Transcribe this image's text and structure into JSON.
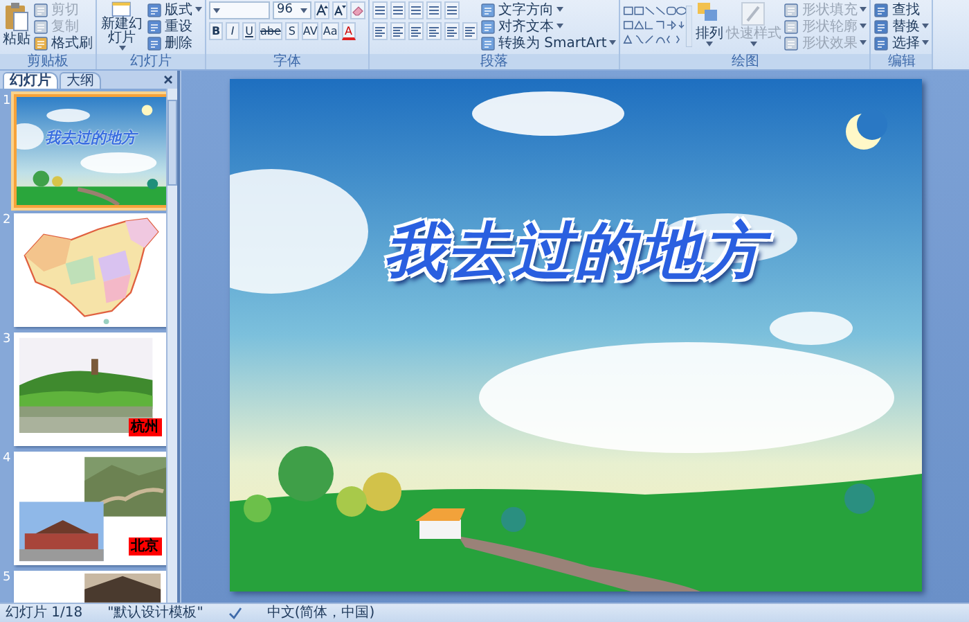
{
  "ribbon": {
    "groups": [
      {
        "kind": "clipboard",
        "label": "剪贴板",
        "paste": "粘贴",
        "commands": [
          {
            "label": "剪切",
            "disabled": true
          },
          {
            "label": "复制",
            "disabled": true
          },
          {
            "label": "格式刷",
            "disabled": false
          }
        ]
      },
      {
        "kind": "slides",
        "label": "幻灯片",
        "new_slide": "新建幻灯片",
        "commands": [
          {
            "label": "版式",
            "disabled": false
          },
          {
            "label": "重设",
            "disabled": false
          },
          {
            "label": "删除",
            "disabled": false
          }
        ]
      },
      {
        "kind": "font",
        "label": "字体",
        "font_size": "96",
        "style_buttons": [
          "B",
          "I",
          "U",
          "abe",
          "S",
          "AV",
          "Aa",
          "A"
        ]
      },
      {
        "kind": "paragraph",
        "label": "段落",
        "commands": [
          {
            "label": "文字方向",
            "disabled": false
          },
          {
            "label": "对齐文本",
            "disabled": false
          },
          {
            "label": "转换为 SmartArt",
            "disabled": false
          }
        ]
      },
      {
        "kind": "drawing",
        "label": "绘图",
        "arrange": "排列",
        "quick_styles": {
          "label": "快速样式",
          "disabled": true
        },
        "commands": [
          {
            "label": "形状填充",
            "disabled": true
          },
          {
            "label": "形状轮廓",
            "disabled": true
          },
          {
            "label": "形状效果",
            "disabled": true
          }
        ]
      },
      {
        "kind": "editing",
        "label": "编辑",
        "commands": [
          {
            "label": "查找",
            "disabled": false
          },
          {
            "label": "替换",
            "disabled": false
          },
          {
            "label": "选择",
            "disabled": false
          }
        ]
      }
    ]
  },
  "panel_tabs": [
    {
      "label": "幻灯片",
      "selected": true
    },
    {
      "label": "大纲",
      "selected": false
    }
  ],
  "thumbnails": [
    {
      "number": "1",
      "selected": true,
      "kind": "title",
      "title": "我去过的地方"
    },
    {
      "number": "2",
      "selected": false,
      "kind": "map"
    },
    {
      "number": "3",
      "selected": false,
      "caption": "杭州"
    },
    {
      "number": "4",
      "selected": false,
      "kind": "photos",
      "caption": "北京"
    },
    {
      "number": "5",
      "selected": false,
      "kind": "partial"
    }
  ],
  "slide": {
    "title": "我去过的地方"
  },
  "status_bar": {
    "slide_count": "幻灯片 1/18",
    "theme": "\"默认设计模板\"",
    "language": "中文(简体，中国)"
  }
}
